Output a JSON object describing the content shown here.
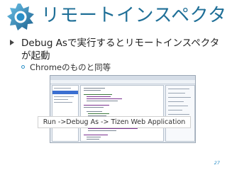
{
  "slide": {
    "title": "リモートインスペクタ",
    "bullet1": "Debug Asで実行するとリモートインスペクタが起動",
    "bullet2": "Chromeのものと同等",
    "caption": "Run ->Debug As ->  Tizen Web Application",
    "page_number": "27"
  },
  "colors": {
    "accent": "#1f6f97",
    "bullet_marker": "#2b8fc7"
  }
}
